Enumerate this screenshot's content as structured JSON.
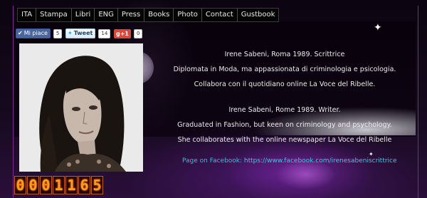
{
  "nav": {
    "items": [
      "ITA",
      "Stampa",
      "Libri",
      "ENG",
      "Press",
      "Books",
      "Photo",
      "Contact",
      "Gustbook"
    ]
  },
  "social": {
    "facebook": {
      "label": "Mi piace",
      "count": "5"
    },
    "twitter": {
      "label": "Tweet",
      "count": "14"
    },
    "google": {
      "label": "g+1",
      "count": "0"
    }
  },
  "bio": {
    "it": [
      "Irene Sabeni, Roma 1989. Scrittrice",
      "Diplomata in Moda, ma appassionata di criminologia e psicologia.",
      "Collabora con il quotidiano online La Voce del Ribelle."
    ],
    "en": [
      "Irene Sabeni, Rome 1989. Writer.",
      "Graduated in Fashion, but keen on criminology and psychology.",
      "She collaborates with the online newspaper La Voce del Ribelle"
    ]
  },
  "facebook_link": {
    "label": "Page on Facebook:",
    "url": "https://www.facebook.com/irenesabeniscrittrice"
  },
  "counter": {
    "digits": [
      "0",
      "0",
      "0",
      "1",
      "1",
      "6",
      "5"
    ]
  },
  "colors": {
    "accent": "#7a2a8a",
    "link": "#30d0e6",
    "counter": "#ff9a20"
  }
}
